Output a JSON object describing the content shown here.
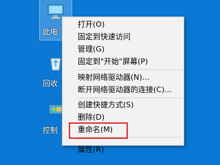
{
  "desktop": {
    "icons": [
      {
        "label": "此电",
        "icon": "computer-icon"
      },
      {
        "label": "回收",
        "icon": "recycle-bin-icon"
      },
      {
        "label": "控制",
        "icon": "control-panel-icon"
      }
    ]
  },
  "context_menu": {
    "items": [
      {
        "label": "打开(O)"
      },
      {
        "label": "固定到快速访问"
      },
      {
        "label": "管理(G)"
      },
      {
        "label": "固定到\"开始\"屏幕(P)"
      },
      {
        "label": "映射网络驱动器(N)..."
      },
      {
        "label": "断开网络驱动器的连接(C)..."
      },
      {
        "label": "创建快捷方式(S)"
      },
      {
        "label": "删除(D)"
      },
      {
        "label": "重命名(M)"
      },
      {
        "label": "属性(R)"
      }
    ],
    "highlight_color": "#e03030"
  }
}
